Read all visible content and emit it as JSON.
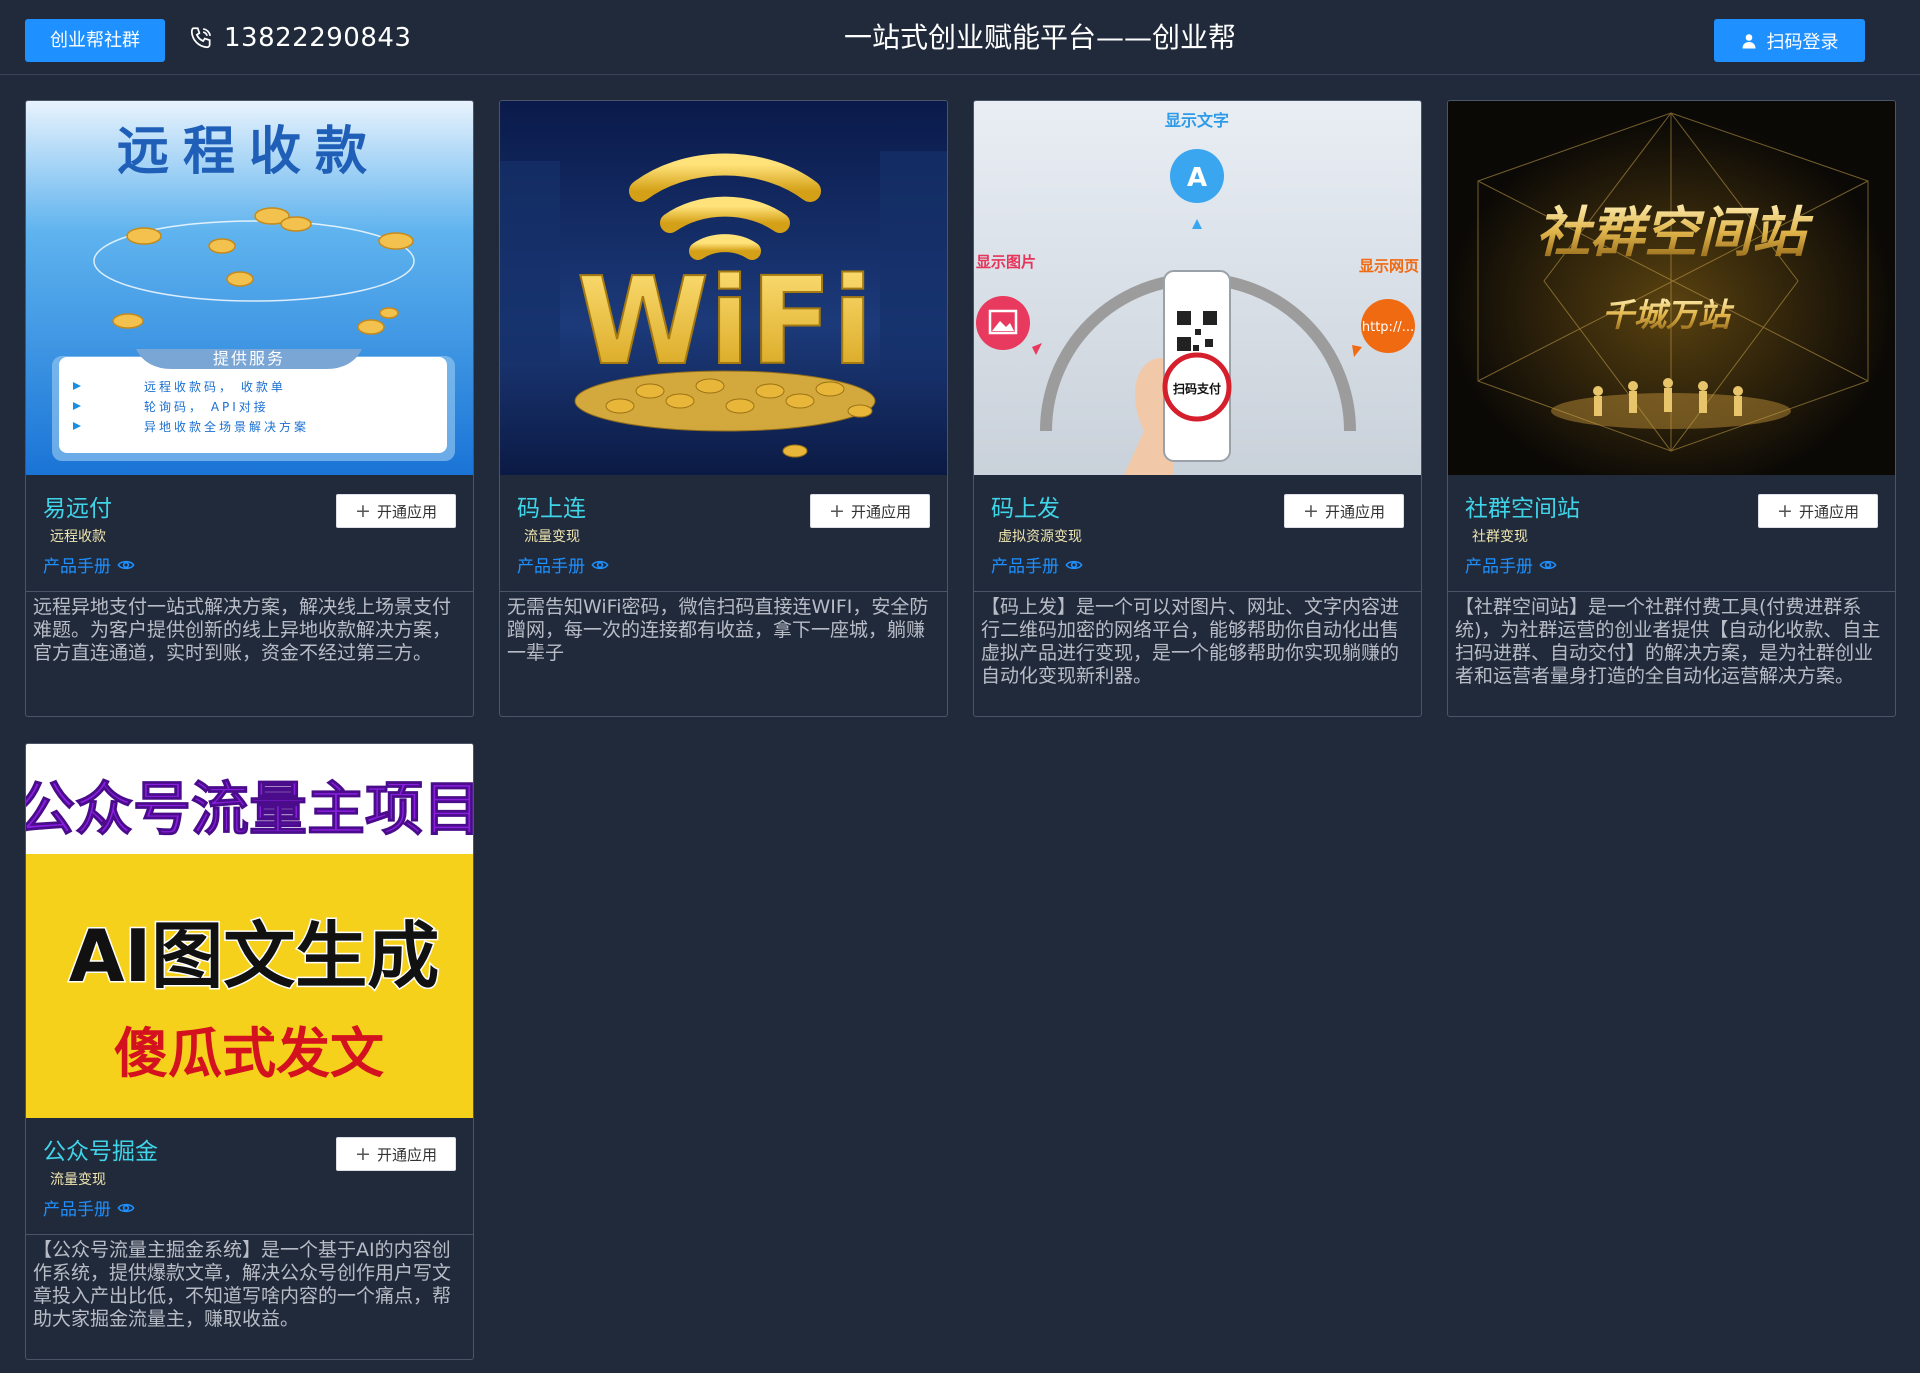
{
  "header": {
    "community_button": "创业帮社群",
    "phone": "13822290843",
    "title": "一站式创业赋能平台——创业帮",
    "login_button": "扫码登录"
  },
  "card_common": {
    "open_button": "开通应用",
    "manual_label": "产品手册"
  },
  "cards": [
    {
      "name": "易远付",
      "tag": "远程收款",
      "desc": "远程异地支付一站式解决方案，解决线上场景支付难题。为客户提供创新的线上异地收款解决方案，官方直连通道，实时到账，资金不经过第三方。",
      "image": {
        "headline": "远程收款",
        "panel_title": "提供服务",
        "bullets": [
          "远程收款码， 收款单",
          "轮询码， API对接",
          "异地收款全场景解决方案"
        ]
      }
    },
    {
      "name": "码上连",
      "tag": "流量变现",
      "desc": "无需告知WiFi密码，微信扫码直接连WIFI，安全防蹭网，每一次的连接都有收益，拿下一座城，躺赚一辈子",
      "image": {
        "headline": "WiFi"
      }
    },
    {
      "name": "码上发",
      "tag": "虚拟资源变现",
      "desc": "【码上发】是一个可以对图片、网址、文字内容进行二维码加密的网络平台，能够帮助你自动化出售虚拟产品进行变现，是一个能够帮助你实现躺赚的自动化变现新利器。",
      "image": {
        "label_text": "显示文字",
        "label_image": "显示图片",
        "label_web": "显示网页",
        "url_text": "http://...",
        "pay_text": "扫码支付"
      }
    },
    {
      "name": "社群空间站",
      "tag": "社群变现",
      "desc": "【社群空间站】是一个社群付费工具(付费进群系统)，为社群运营的创业者提供【自动化收款、自主扫码进群、自动交付】的解决方案，是为社群创业者和运营者量身打造的全自动化运营解决方案。",
      "image": {
        "headline": "社群空间站",
        "subline": "千城万站"
      }
    },
    {
      "name": "公众号掘金",
      "tag": "流量变现",
      "desc": "【公众号流量主掘金系统】是一个基于AI的内容创作系统，提供爆款文章，解决公众号创作用户写文章投入产出比低，不知道写啥内容的一个痛点，帮助大家掘金流量主，赚取收益。",
      "image": {
        "line1": "公众号流量主项目",
        "line2": "AI图文生成",
        "line3": "傻瓜式发文"
      }
    }
  ],
  "colors": {
    "background": "#212a3b",
    "accent_blue": "#1e90ff",
    "product_name": "#40d4e8",
    "tag_text": "#f0e6b0",
    "desc_text": "#b8bcc6"
  },
  "icons": {
    "phone": "phone-icon",
    "login": "user-icon",
    "manual": "eye-icon",
    "open": "plus-icon"
  }
}
